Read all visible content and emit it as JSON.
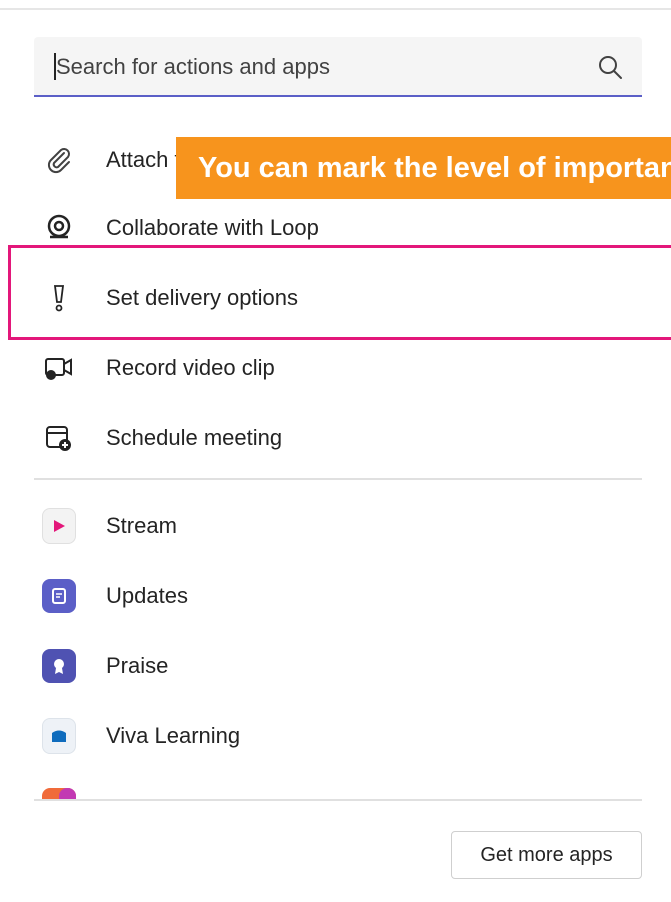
{
  "search": {
    "placeholder": "Search for actions and apps",
    "icon": "search-icon"
  },
  "actions": [
    {
      "label": "Attach file",
      "icon": "paperclip-icon"
    },
    {
      "label": "Collaborate with Loop",
      "icon": "loop-icon"
    },
    {
      "label": "Set delivery options",
      "icon": "exclamation-icon"
    },
    {
      "label": "Record video clip",
      "icon": "video-clip-icon"
    },
    {
      "label": "Schedule meeting",
      "icon": "calendar-add-icon"
    }
  ],
  "apps": [
    {
      "label": "Stream",
      "icon": "stream-app-icon",
      "color": "#e8e8e8"
    },
    {
      "label": "Updates",
      "icon": "updates-app-icon",
      "color": "#5b5fc7"
    },
    {
      "label": "Praise",
      "icon": "praise-app-icon",
      "color": "#4f52b2"
    },
    {
      "label": "Viva Learning",
      "icon": "viva-learning-app-icon",
      "color": "#e8eef5"
    }
  ],
  "annotation": {
    "tooltip": "You can mark the level of importance"
  },
  "footer": {
    "more_button": "Get more apps"
  },
  "colors": {
    "accent": "#5b5fc7",
    "highlight": "#e3177a",
    "tooltip": "#f7941d"
  }
}
